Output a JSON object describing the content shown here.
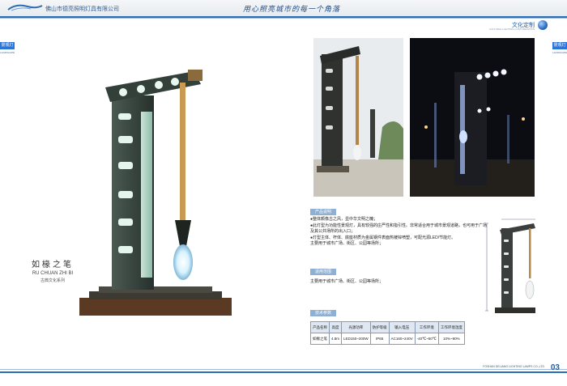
{
  "header": {
    "company": "佛山市德亮照明灯具有限公司",
    "slogan": "用心照亮城市的每一个角落"
  },
  "brand": {
    "name": "文化定制",
    "sub": "CULTURAL LIGHTING CUSTOMIZATION"
  },
  "side_tabs": {
    "left": "景观灯",
    "left_sub": "LANDSCAPE",
    "right": "景观灯",
    "right_sub": "LANDSCAPE"
  },
  "product": {
    "name_cn": "如椽之笔",
    "name_en": "RU CHUAN ZHI BI",
    "series": "古典文化系列"
  },
  "features": {
    "label": "产品说明",
    "bullets": [
      "●整体颇像古之风，显中华文明之魄；",
      "●此灯型为功能性景观灯，具有较强的庄严性和指引性。非常适合用于城市景观道路，也可用于广场及其公共场所的出入口；",
      "●灯型主体、杆体、底座材质为金属钢件表面热镀锌喷塑，可配光源LED/节能灯。",
      "主要用于城市广场、街区、公园等场所；"
    ]
  },
  "usage": {
    "label": "适用范围",
    "text": "主要用于城市广场、街区、公园等场所；"
  },
  "specs": {
    "label": "技术参数",
    "headers": [
      "产品名称",
      "高度",
      "光源功率",
      "防护等级",
      "输入电压",
      "工作环境",
      "工作环境湿度"
    ],
    "row": [
      "如椽之笔",
      "4.8m",
      "LED150~200W",
      "IP65",
      "AC160~240V",
      "-40℃~50℃",
      "10%~90%"
    ]
  },
  "footer": {
    "company": "FOSHAN DELIANG LIGHTING LAMPS CO.,LTD",
    "page": "03"
  }
}
